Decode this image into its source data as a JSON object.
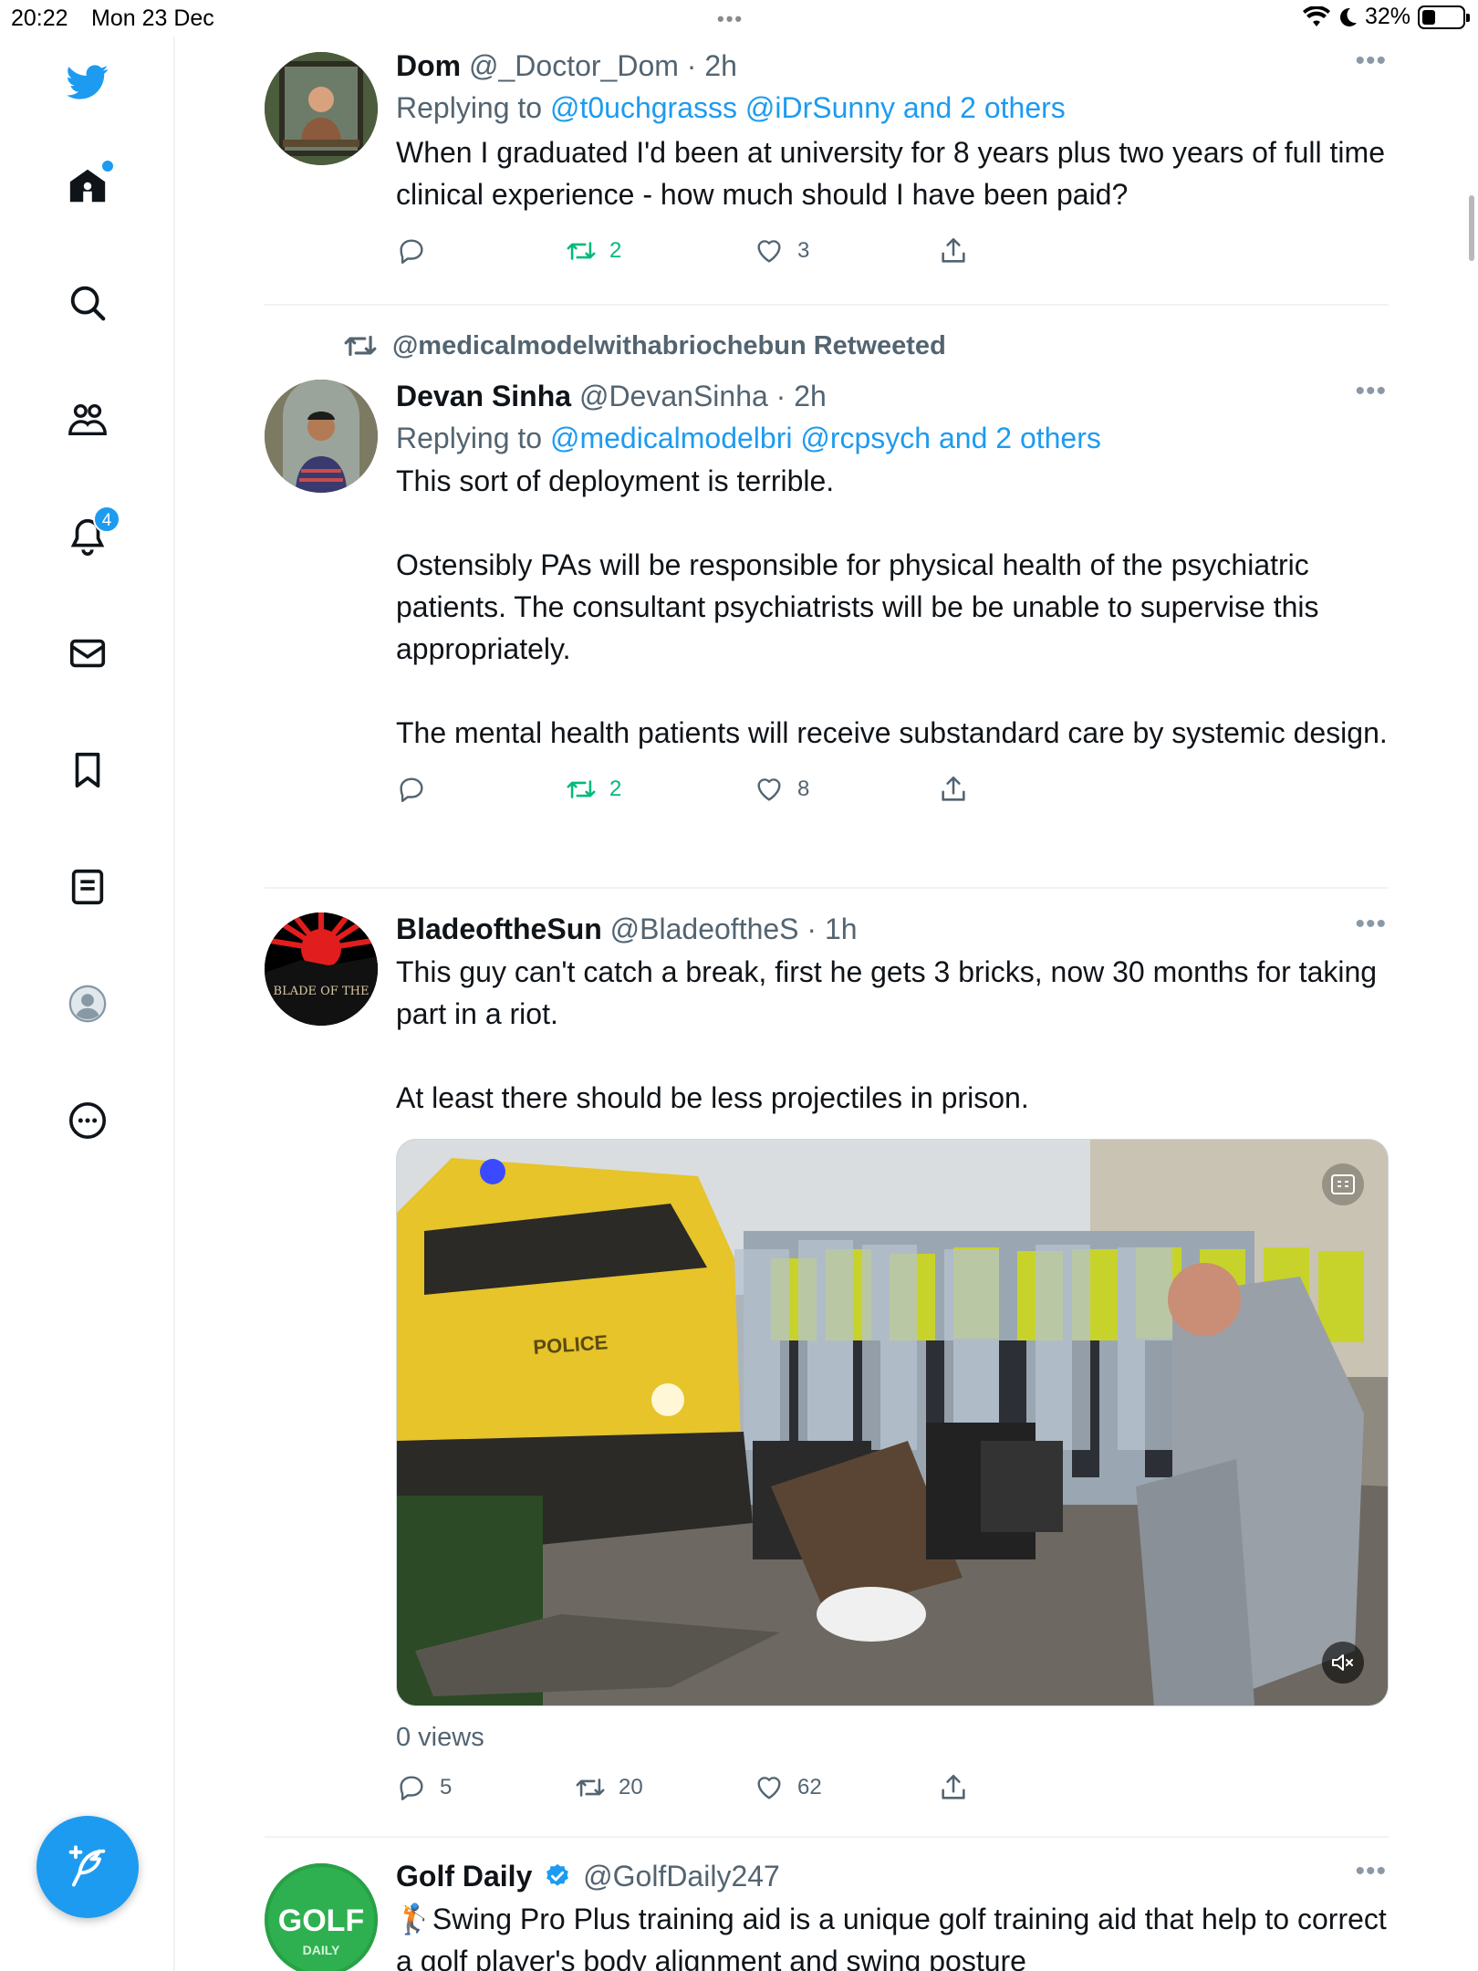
{
  "status_bar": {
    "time": "20:22",
    "date": "Mon 23 Dec",
    "battery": "32%"
  },
  "sidebar": {
    "notifications_badge": "4",
    "items": [
      "twitter-logo",
      "home",
      "explore",
      "communities",
      "notifications",
      "messages",
      "bookmarks",
      "lists",
      "profile",
      "more"
    ]
  },
  "tweets": [
    {
      "name": "Dom",
      "handle": "@_Doctor_Dom",
      "time": "2h",
      "reply_prefix": "Replying to",
      "reply_to": "@t0uchgrasss @iDrSunny and 2 others",
      "text": "When I graduated I'd been at university for 8 years plus two years of full time clinical experience - how much should I have been paid?",
      "replies": "",
      "retweets": "2",
      "likes": "3"
    },
    {
      "retweeted_by": "@medicalmodelwithabriochebun Retweeted",
      "name": "Devan Sinha",
      "handle": "@DevanSinha",
      "time": "2h",
      "reply_prefix": "Replying to",
      "reply_to": "@medicalmodelbri @rcpsych and 2 others",
      "text": "This sort of deployment is terrible.\n\nOstensibly PAs will be responsible for physical health of the psychiatric patients. The consultant psychiatrists will be be unable to supervise this appropriately.\n\nThe mental health patients will receive substandard care by systemic design.",
      "replies": "",
      "retweets": "2",
      "likes": "8"
    },
    {
      "name": "BladeoftheSun",
      "handle": "@BladeoftheS",
      "time": "1h",
      "avatar_text": "BLADE OF THE",
      "text": "This guy can't catch a break, first he gets 3 bricks, now 30 months for taking part in a riot.\n\nAt least there should be less projectiles in prison.",
      "media_text": "POLICE",
      "views": "0 views",
      "replies": "5",
      "retweets": "20",
      "likes": "62"
    },
    {
      "name": "Golf Daily",
      "handle": "@GolfDaily247",
      "avatar_text": "GOLF",
      "avatar_subtext": "DAILY",
      "text": "🏌️Swing Pro Plus training aid is a unique golf training aid that help to correct a golf player's body alignment and swing posture"
    }
  ],
  "colors": {
    "accent": "#1d9bf0",
    "retweet": "#00ba7c",
    "muted": "#536471"
  }
}
